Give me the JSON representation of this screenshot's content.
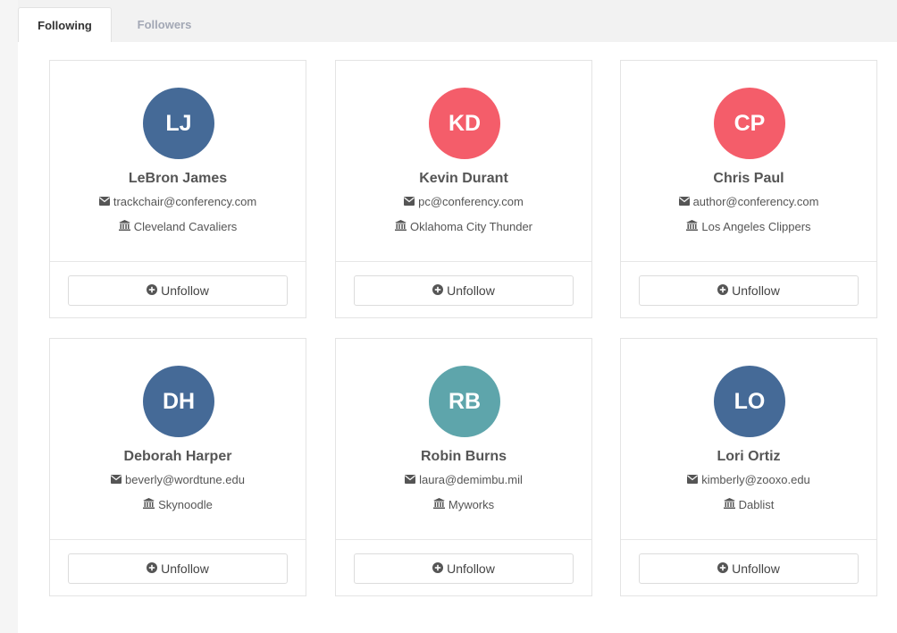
{
  "tabs": [
    {
      "label": "Following",
      "active": true
    },
    {
      "label": "Followers",
      "active": false
    }
  ],
  "colors": {
    "blue": "#456a97",
    "red": "#f45d6a",
    "teal": "#5ea5ab"
  },
  "cards": [
    {
      "initials": "LJ",
      "color": "#456a97",
      "name": "LeBron James",
      "email": "trackchair@conferency.com",
      "team": "Cleveland Cavaliers",
      "button": "Unfollow"
    },
    {
      "initials": "KD",
      "color": "#f45d6a",
      "name": "Kevin Durant",
      "email": "pc@conferency.com",
      "team": "Oklahoma City Thunder",
      "button": "Unfollow"
    },
    {
      "initials": "CP",
      "color": "#f45d6a",
      "name": "Chris Paul",
      "email": "author@conferency.com",
      "team": "Los Angeles Clippers",
      "button": "Unfollow"
    },
    {
      "initials": "DH",
      "color": "#456a97",
      "name": "Deborah Harper",
      "email": "beverly@wordtune.edu",
      "team": "Skynoodle",
      "button": "Unfollow"
    },
    {
      "initials": "RB",
      "color": "#5ea5ab",
      "name": "Robin Burns",
      "email": "laura@demimbu.mil",
      "team": "Myworks",
      "button": "Unfollow"
    },
    {
      "initials": "LO",
      "color": "#456a97",
      "name": "Lori Ortiz",
      "email": "kimberly@zooxo.edu",
      "team": "Dablist",
      "button": "Unfollow"
    }
  ],
  "icons": {
    "email": "envelope-icon",
    "team": "institution-icon",
    "button": "plus-circle-icon"
  }
}
